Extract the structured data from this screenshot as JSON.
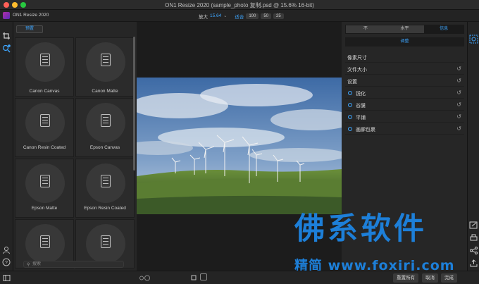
{
  "window": {
    "title": "ON1 Resize 2020 (sample_photo 复制.psd @ 15.6% 16-bit)"
  },
  "toolbar": {
    "app_name": "ON1 Resize 2020",
    "zoom_label": "放大",
    "zoom_value": "15.64",
    "fit_label": "适合",
    "zoom_presets": [
      "100",
      "50",
      "25"
    ]
  },
  "presets": {
    "tab_label": "预置",
    "items": [
      "",
      "",
      "Canon Canvas",
      "Canon Matte",
      "Canon Resin Coated",
      "Epson Canvas",
      "Epson Matte",
      "Epson Resin Coated",
      "",
      ""
    ],
    "search_placeholder": "搜索"
  },
  "right_panel": {
    "view_tabs": [
      "不",
      "水平",
      "信息"
    ],
    "adjust_label": "调整",
    "sections": [
      {
        "label": "像素尺寸",
        "radio": false,
        "reset": false
      },
      {
        "label": "文件大小",
        "radio": false,
        "reset": true
      },
      {
        "label": "设置",
        "radio": false,
        "reset": true
      },
      {
        "label": "锐化",
        "radio": true,
        "reset": true
      },
      {
        "label": "谷膜",
        "radio": true,
        "reset": true
      },
      {
        "label": "平铺",
        "radio": true,
        "reset": true
      },
      {
        "label": "画廊包裹",
        "radio": true,
        "reset": true
      }
    ]
  },
  "bottom": {
    "reset_all": "重置所有",
    "cancel": "取消",
    "done": "完成"
  },
  "watermark": {
    "big": "佛系软件",
    "small": "精简 www.foxirj.com"
  },
  "colors": {
    "accent": "#3ea6ff",
    "watermark": "#1d7fd8"
  }
}
